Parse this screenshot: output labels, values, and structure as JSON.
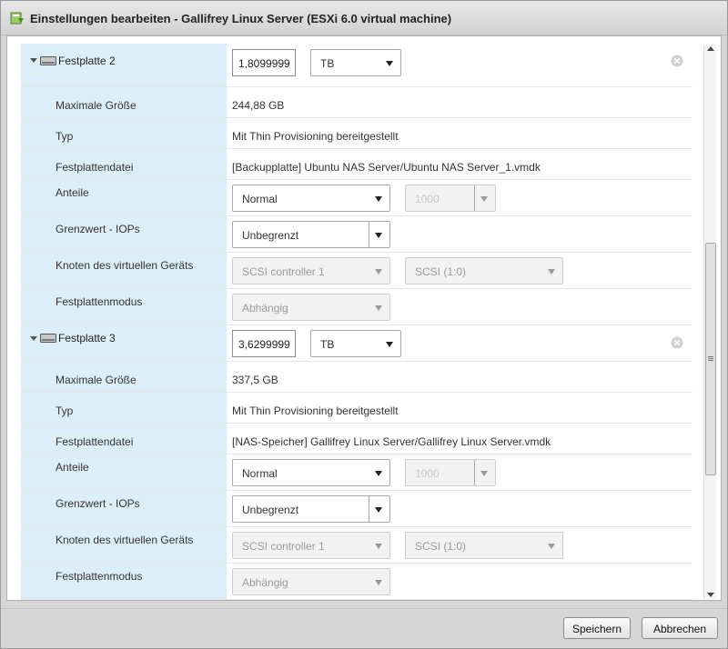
{
  "window": {
    "title": "Einstellungen bearbeiten - Gallifrey Linux Server (ESXi 6.0 virtual machine)"
  },
  "disks": [
    {
      "name": "Festplatte 2",
      "size_value": "1,8099999",
      "size_unit": "TB",
      "rows": {
        "max_size": {
          "label": "Maximale Größe",
          "value": "244,88 GB"
        },
        "type": {
          "label": "Typ",
          "value": "Mit Thin Provisioning bereitgestellt"
        },
        "file": {
          "label": "Festplattendatei",
          "value": "[Backupplatte] Ubuntu NAS Server/Ubuntu NAS Server_1.vmdk"
        },
        "shares": {
          "label": "Anteile",
          "value": "Normal",
          "amount": "1000"
        },
        "iops": {
          "label": "Grenzwert - IOPs",
          "value": "Unbegrenzt"
        },
        "node": {
          "label": "Knoten des virtuellen Geräts",
          "controller": "SCSI controller 1",
          "slot": "SCSI (1:0)"
        },
        "mode": {
          "label": "Festplattenmodus",
          "value": "Abhängig"
        }
      }
    },
    {
      "name": "Festplatte 3",
      "size_value": "3,6299999",
      "size_unit": "TB",
      "rows": {
        "max_size": {
          "label": "Maximale Größe",
          "value": "337,5 GB"
        },
        "type": {
          "label": "Typ",
          "value": "Mit Thin Provisioning bereitgestellt"
        },
        "file": {
          "label": "Festplattendatei",
          "value": "[NAS-Speicher] Gallifrey Linux Server/Gallifrey Linux Server.vmdk"
        },
        "shares": {
          "label": "Anteile",
          "value": "Normal",
          "amount": "1000"
        },
        "iops": {
          "label": "Grenzwert - IOPs",
          "value": "Unbegrenzt"
        },
        "node": {
          "label": "Knoten des virtuellen Geräts",
          "controller": "SCSI controller 1",
          "slot": "SCSI (1:0)"
        },
        "mode": {
          "label": "Festplattenmodus",
          "value": "Abhängig"
        }
      }
    }
  ],
  "footer": {
    "save_label": "Speichern",
    "cancel_label": "Abbrechen"
  },
  "colors": {
    "label_column_bg": "#dceff8",
    "dialog_bg": "#d6d6d6",
    "disabled_text": "#9a9a9a"
  },
  "icons": {
    "title": "vm-settings-icon",
    "disk": "hard-disk-icon",
    "remove": "remove-circle-icon",
    "expander": "triangle-down-icon"
  }
}
